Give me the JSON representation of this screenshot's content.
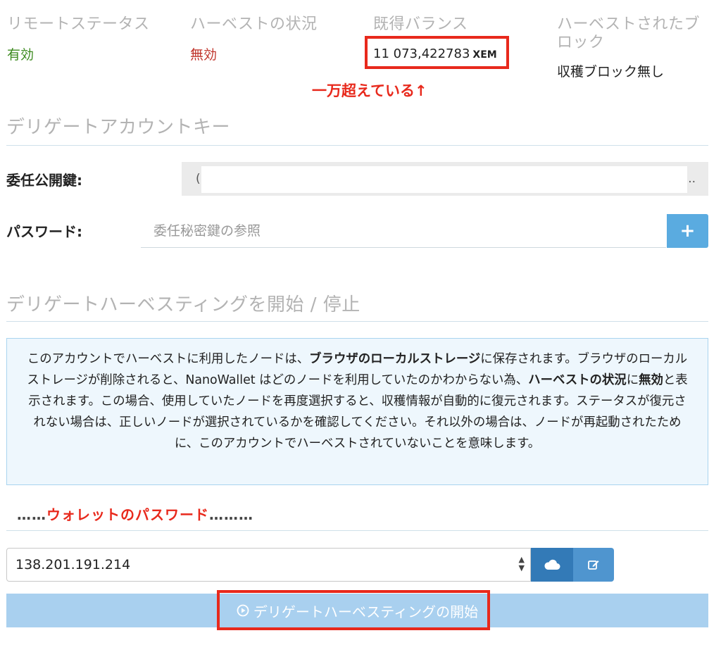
{
  "status": {
    "remote_status_label": "リモートステータス",
    "remote_status_value": "有効",
    "harvest_status_label": "ハーベストの状況",
    "harvest_status_value": "無効",
    "vested_balance_label": "既得バランス",
    "vested_balance_value": "11 073,422783",
    "vested_balance_unit": "XEM",
    "harvested_blocks_label": "ハーベストされたブロック",
    "harvested_blocks_value": "収穫ブロック無し"
  },
  "annotations": {
    "balance_note": "一万超えている↑",
    "wallet_password_dots_left": "……",
    "wallet_password_label": "ウォレットのパスワード",
    "wallet_password_dots_right": "………"
  },
  "delegate_key": {
    "section_title": "デリゲートアカウントキー",
    "public_key_label": "委任公開鍵:",
    "public_key_first_char": "(",
    "public_key_ellipsis": "..",
    "password_label": "パスワード:",
    "password_placeholder": "委任秘密鍵の参照",
    "add_button_symbol": "+"
  },
  "harvesting": {
    "section_title": "デリゲートハーベスティングを開始 / 停止",
    "info_parts": [
      "このアカウントでハーベストに利用したノードは、",
      "ブラウザのローカルストレージ",
      "に保存されます。ブラウザのローカルストレージが削除されると、NanoWallet はどのノードを利用していたのかわからない為、",
      "ハーベストの状況",
      "に",
      "無効",
      "と表示されます。この場合、使用していたノードを再度選択すると、収穫情報が自動的に復元されます。ステータスが復元されない場合は、正しいノードが選択されているかを確認してください。それ以外の場合は、ノードが再起動されたために、このアカウントでハーベストされていないことを意味します。"
    ],
    "node_value": "138.201.191.214",
    "start_button_label": "デリゲートハーベスティングの開始"
  },
  "colors": {
    "accent_blue": "#5aabe0",
    "annotation_red": "#e8291c",
    "active_green": "#3c8a1e",
    "inactive_red": "#c0342b"
  },
  "icons": {
    "plus": "plus-icon",
    "cloud": "cloud-icon",
    "edit": "edit-icon",
    "play": "play-circle-icon",
    "select_arrows": "select-arrows-icon"
  }
}
